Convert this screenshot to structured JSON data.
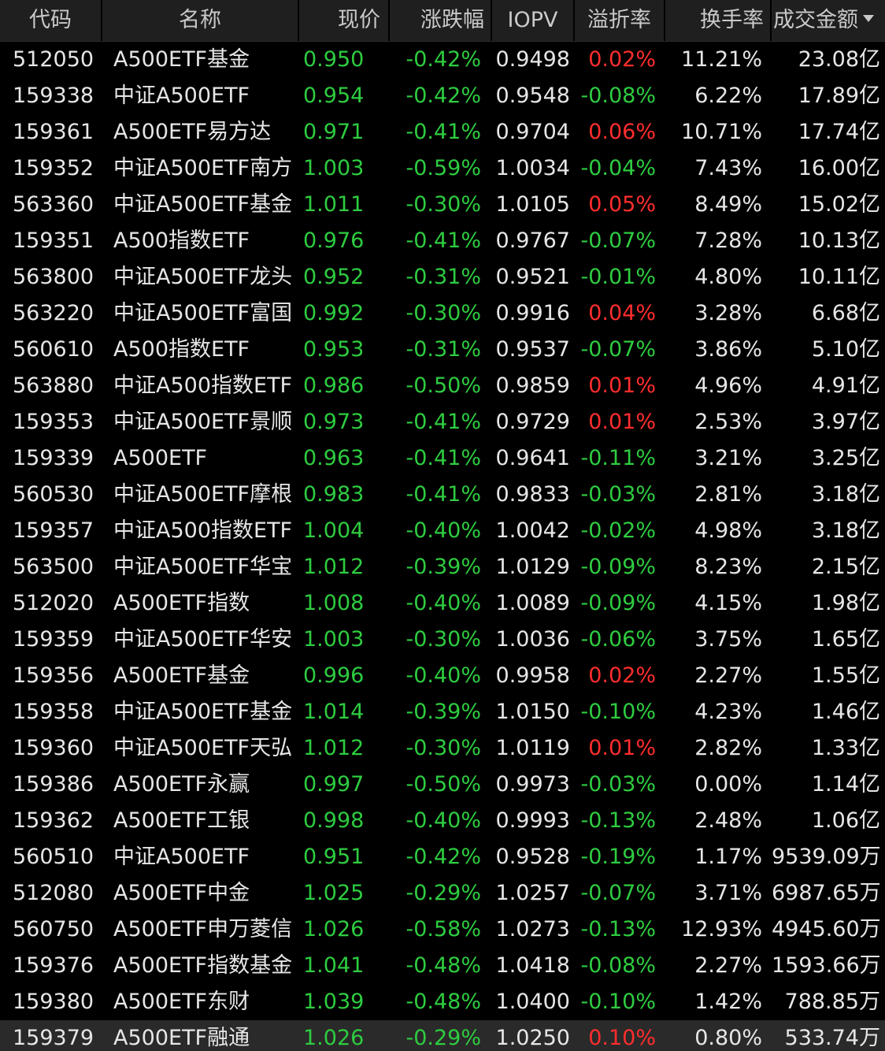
{
  "colors": {
    "up": "#ff2d2d",
    "down": "#2ecc40",
    "text": "#e6e6e6",
    "header_bg": "#1f1f1f",
    "selected_bg": "#2a2a2a"
  },
  "header": {
    "code": "代码",
    "name": "名称",
    "price": "现价",
    "change": "涨跌幅",
    "iopv": "IOPV",
    "premium": "溢折率",
    "turnover": "换手率",
    "amount": "成交金额",
    "amount_sort_icon": "sort-desc-icon"
  },
  "rows": [
    {
      "code": "512050",
      "name": "A500ETF基金",
      "price": "0.950",
      "change": "-0.42%",
      "iopv": "0.9498",
      "premium": "0.02%",
      "premium_dir": "up",
      "turnover": "11.21%",
      "amount": "23.08亿"
    },
    {
      "code": "159338",
      "name": "中证A500ETF",
      "price": "0.954",
      "change": "-0.42%",
      "iopv": "0.9548",
      "premium": "-0.08%",
      "premium_dir": "down",
      "turnover": "6.22%",
      "amount": "17.89亿"
    },
    {
      "code": "159361",
      "name": "A500ETF易方达",
      "price": "0.971",
      "change": "-0.41%",
      "iopv": "0.9704",
      "premium": "0.06%",
      "premium_dir": "up",
      "turnover": "10.71%",
      "amount": "17.74亿"
    },
    {
      "code": "159352",
      "name": "中证A500ETF南方",
      "price": "1.003",
      "change": "-0.59%",
      "iopv": "1.0034",
      "premium": "-0.04%",
      "premium_dir": "down",
      "turnover": "7.43%",
      "amount": "16.00亿"
    },
    {
      "code": "563360",
      "name": "中证A500ETF基金",
      "price": "1.011",
      "change": "-0.30%",
      "iopv": "1.0105",
      "premium": "0.05%",
      "premium_dir": "up",
      "turnover": "8.49%",
      "amount": "15.02亿"
    },
    {
      "code": "159351",
      "name": "A500指数ETF",
      "price": "0.976",
      "change": "-0.41%",
      "iopv": "0.9767",
      "premium": "-0.07%",
      "premium_dir": "down",
      "turnover": "7.28%",
      "amount": "10.13亿"
    },
    {
      "code": "563800",
      "name": "中证A500ETF龙头",
      "price": "0.952",
      "change": "-0.31%",
      "iopv": "0.9521",
      "premium": "-0.01%",
      "premium_dir": "down",
      "turnover": "4.80%",
      "amount": "10.11亿"
    },
    {
      "code": "563220",
      "name": "中证A500ETF富国",
      "price": "0.992",
      "change": "-0.30%",
      "iopv": "0.9916",
      "premium": "0.04%",
      "premium_dir": "up",
      "turnover": "3.28%",
      "amount": "6.68亿"
    },
    {
      "code": "560610",
      "name": "A500指数ETF",
      "price": "0.953",
      "change": "-0.31%",
      "iopv": "0.9537",
      "premium": "-0.07%",
      "premium_dir": "down",
      "turnover": "3.86%",
      "amount": "5.10亿"
    },
    {
      "code": "563880",
      "name": "中证A500指数ETF",
      "price": "0.986",
      "change": "-0.50%",
      "iopv": "0.9859",
      "premium": "0.01%",
      "premium_dir": "up",
      "turnover": "4.96%",
      "amount": "4.91亿"
    },
    {
      "code": "159353",
      "name": "中证A500ETF景顺",
      "price": "0.973",
      "change": "-0.41%",
      "iopv": "0.9729",
      "premium": "0.01%",
      "premium_dir": "up",
      "turnover": "2.53%",
      "amount": "3.97亿"
    },
    {
      "code": "159339",
      "name": "A500ETF",
      "price": "0.963",
      "change": "-0.41%",
      "iopv": "0.9641",
      "premium": "-0.11%",
      "premium_dir": "down",
      "turnover": "3.21%",
      "amount": "3.25亿"
    },
    {
      "code": "560530",
      "name": "中证A500ETF摩根",
      "price": "0.983",
      "change": "-0.41%",
      "iopv": "0.9833",
      "premium": "-0.03%",
      "premium_dir": "down",
      "turnover": "2.81%",
      "amount": "3.18亿"
    },
    {
      "code": "159357",
      "name": "中证A500指数ETF",
      "price": "1.004",
      "change": "-0.40%",
      "iopv": "1.0042",
      "premium": "-0.02%",
      "premium_dir": "down",
      "turnover": "4.98%",
      "amount": "3.18亿"
    },
    {
      "code": "563500",
      "name": "中证A500ETF华宝",
      "price": "1.012",
      "change": "-0.39%",
      "iopv": "1.0129",
      "premium": "-0.09%",
      "premium_dir": "down",
      "turnover": "8.23%",
      "amount": "2.15亿"
    },
    {
      "code": "512020",
      "name": "A500ETF指数",
      "price": "1.008",
      "change": "-0.40%",
      "iopv": "1.0089",
      "premium": "-0.09%",
      "premium_dir": "down",
      "turnover": "4.15%",
      "amount": "1.98亿"
    },
    {
      "code": "159359",
      "name": "中证A500ETF华安",
      "price": "1.003",
      "change": "-0.30%",
      "iopv": "1.0036",
      "premium": "-0.06%",
      "premium_dir": "down",
      "turnover": "3.75%",
      "amount": "1.65亿"
    },
    {
      "code": "159356",
      "name": "A500ETF基金",
      "price": "0.996",
      "change": "-0.40%",
      "iopv": "0.9958",
      "premium": "0.02%",
      "premium_dir": "up",
      "turnover": "2.27%",
      "amount": "1.55亿"
    },
    {
      "code": "159358",
      "name": "中证A500ETF基金",
      "price": "1.014",
      "change": "-0.39%",
      "iopv": "1.0150",
      "premium": "-0.10%",
      "premium_dir": "down",
      "turnover": "4.23%",
      "amount": "1.46亿"
    },
    {
      "code": "159360",
      "name": "中证A500ETF天弘",
      "price": "1.012",
      "change": "-0.30%",
      "iopv": "1.0119",
      "premium": "0.01%",
      "premium_dir": "up",
      "turnover": "2.82%",
      "amount": "1.33亿"
    },
    {
      "code": "159386",
      "name": "A500ETF永赢",
      "price": "0.997",
      "change": "-0.50%",
      "iopv": "0.9973",
      "premium": "-0.03%",
      "premium_dir": "down",
      "turnover": "0.00%",
      "amount": "1.14亿"
    },
    {
      "code": "159362",
      "name": "A500ETF工银",
      "price": "0.998",
      "change": "-0.40%",
      "iopv": "0.9993",
      "premium": "-0.13%",
      "premium_dir": "down",
      "turnover": "2.48%",
      "amount": "1.06亿"
    },
    {
      "code": "560510",
      "name": "中证A500ETF",
      "price": "0.951",
      "change": "-0.42%",
      "iopv": "0.9528",
      "premium": "-0.19%",
      "premium_dir": "down",
      "turnover": "1.17%",
      "amount": "9539.09万"
    },
    {
      "code": "512080",
      "name": "A500ETF中金",
      "price": "1.025",
      "change": "-0.29%",
      "iopv": "1.0257",
      "premium": "-0.07%",
      "premium_dir": "down",
      "turnover": "3.71%",
      "amount": "6987.65万"
    },
    {
      "code": "560750",
      "name": "A500ETF申万菱信",
      "price": "1.026",
      "change": "-0.58%",
      "iopv": "1.0273",
      "premium": "-0.13%",
      "premium_dir": "down",
      "turnover": "12.93%",
      "amount": "4945.60万"
    },
    {
      "code": "159376",
      "name": "A500ETF指数基金",
      "price": "1.041",
      "change": "-0.48%",
      "iopv": "1.0418",
      "premium": "-0.08%",
      "premium_dir": "down",
      "turnover": "2.27%",
      "amount": "1593.66万"
    },
    {
      "code": "159380",
      "name": "A500ETF东财",
      "price": "1.039",
      "change": "-0.48%",
      "iopv": "1.0400",
      "premium": "-0.10%",
      "premium_dir": "down",
      "turnover": "1.42%",
      "amount": "788.85万"
    },
    {
      "code": "159379",
      "name": "A500ETF融通",
      "price": "1.026",
      "change": "-0.29%",
      "iopv": "1.0250",
      "premium": "0.10%",
      "premium_dir": "up",
      "turnover": "0.80%",
      "amount": "533.74万",
      "selected": true
    }
  ]
}
